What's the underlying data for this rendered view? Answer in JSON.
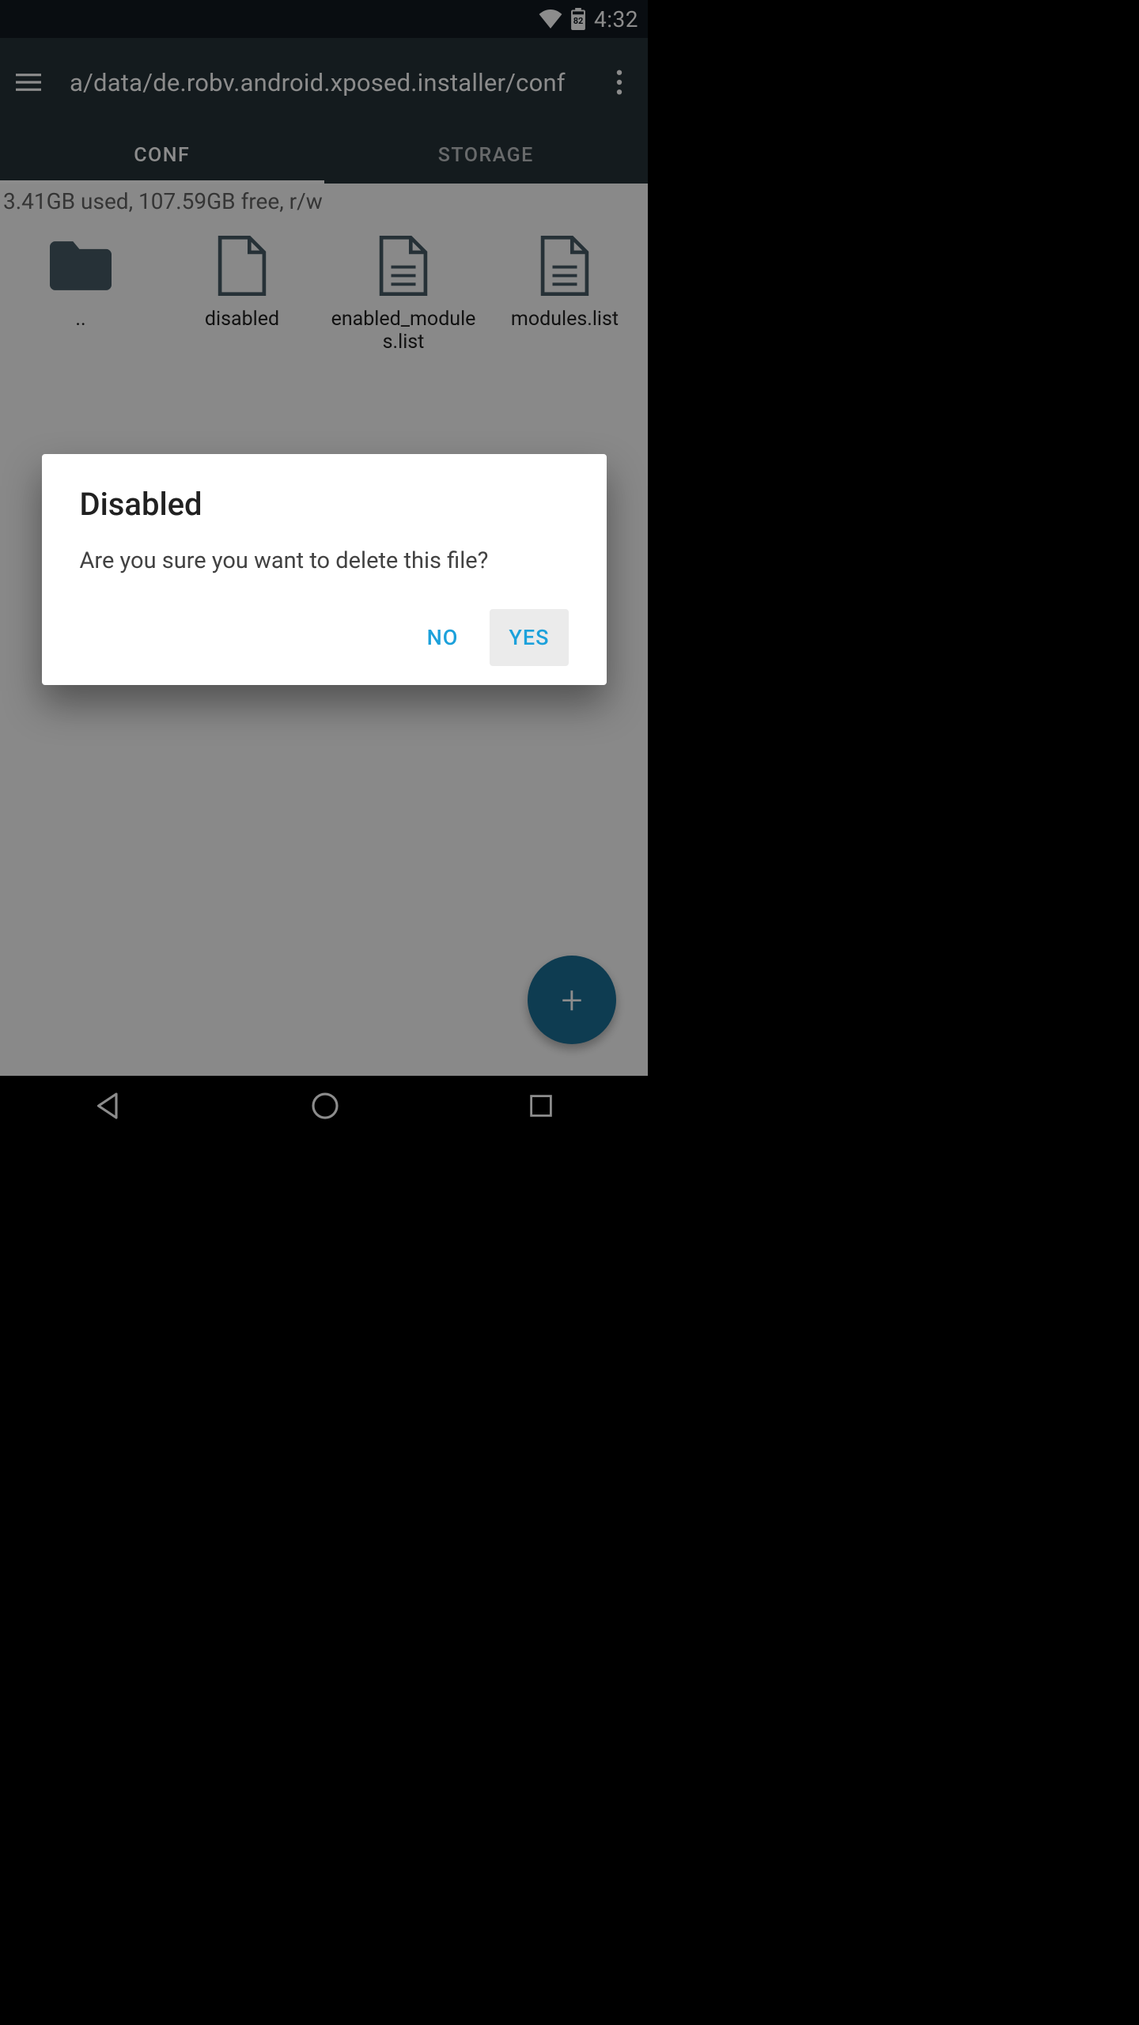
{
  "status": {
    "battery": "82",
    "time": "4:32"
  },
  "appbar": {
    "path": "a/data/de.robv.android.xposed.installer/conf"
  },
  "tabs": [
    {
      "label": "CONF",
      "active": true
    },
    {
      "label": "STORAGE",
      "active": false
    }
  ],
  "storage_info": "3.41GB used, 107.59GB free, r/w",
  "items": [
    {
      "name": "..",
      "type": "folder"
    },
    {
      "name": "disabled",
      "type": "file-blank"
    },
    {
      "name": "enabled_modules.list",
      "type": "file-text"
    },
    {
      "name": "modules.list",
      "type": "file-text"
    }
  ],
  "dialog": {
    "title": "Disabled",
    "message": "Are you sure you want to delete this file?",
    "no": "NO",
    "yes": "YES"
  }
}
